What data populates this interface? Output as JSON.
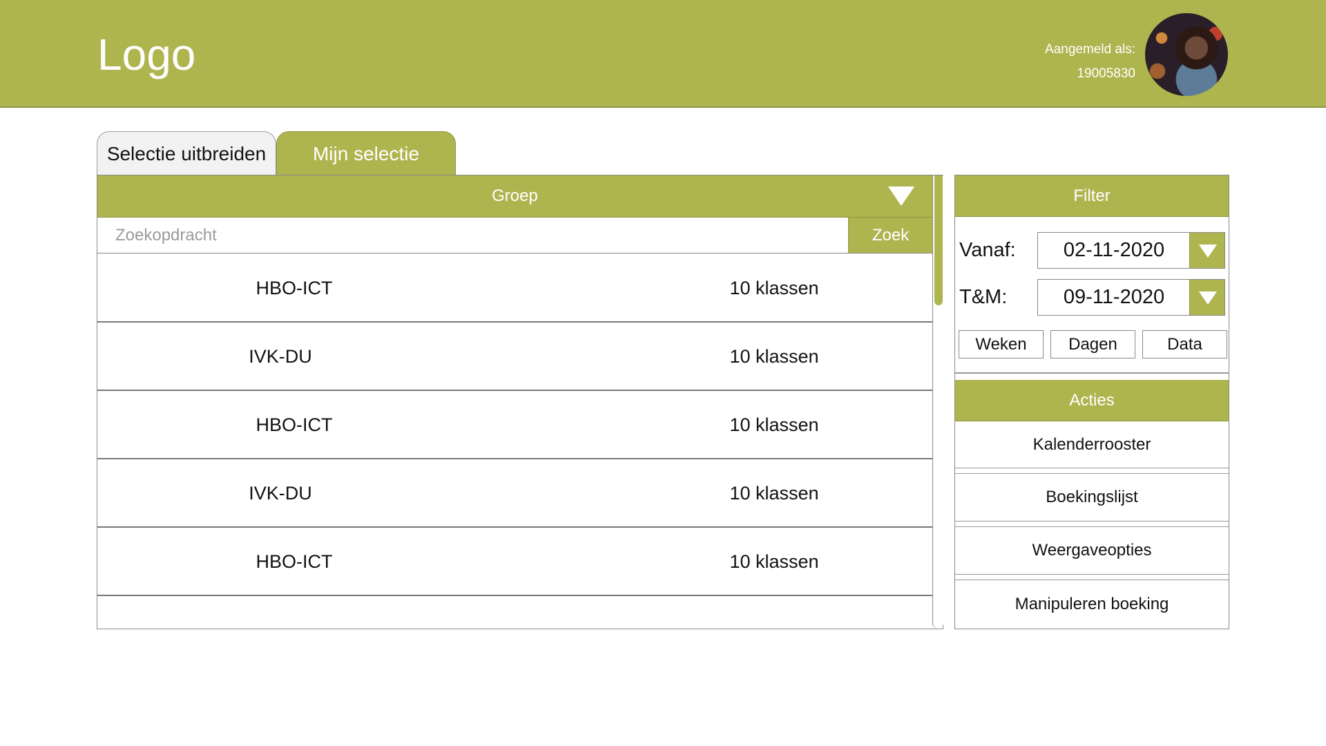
{
  "header": {
    "logo": "Logo",
    "logged_in_label": "Aangemeld als:",
    "user_id": "19005830"
  },
  "tabs": [
    {
      "label": "Selectie uitbreiden"
    },
    {
      "label": "Mijn selectie"
    }
  ],
  "list_panel": {
    "group_label": "Groep",
    "search_placeholder": "Zoekopdracht",
    "search_button": "Zoek",
    "rows": [
      {
        "name": "HBO-ICT",
        "count": "10 klassen"
      },
      {
        "name": "IVK-DU",
        "count": "10 klassen"
      },
      {
        "name": "HBO-ICT",
        "count": "10 klassen"
      },
      {
        "name": "IVK-DU",
        "count": "10 klassen"
      },
      {
        "name": "HBO-ICT",
        "count": "10 klassen"
      }
    ]
  },
  "filter": {
    "title": "Filter",
    "from_label": "Vanaf:",
    "from_value": "02-11-2020",
    "to_label": "T&M:",
    "to_value": "09-11-2020",
    "buttons": [
      "Weken",
      "Dagen",
      "Data"
    ]
  },
  "actions": {
    "title": "Acties",
    "items": [
      "Kalenderrooster",
      "Boekingslijst",
      "Weergaveopties",
      "Manipuleren boeking"
    ]
  },
  "colors": {
    "accent": "#aeb54f",
    "accent_border": "#8e9440"
  },
  "icons": [
    "dropdown-arrow-icon",
    "calendar-dropdown-icon",
    "avatar"
  ]
}
